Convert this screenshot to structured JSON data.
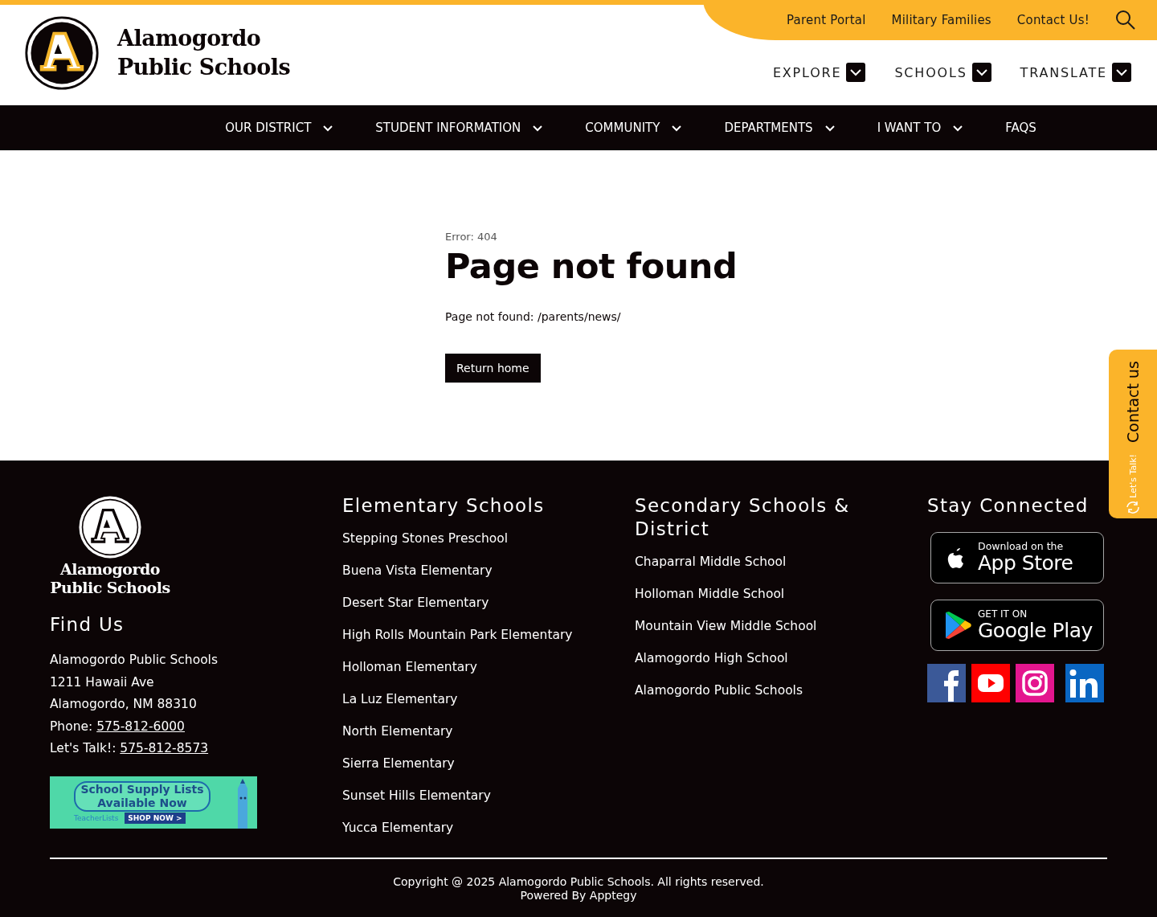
{
  "header": {
    "logo_text": [
      "Alamogordo",
      "Public Schools"
    ],
    "utility_links": [
      "Parent Portal",
      "Military Families",
      "Contact Us!"
    ],
    "dropdowns": [
      "EXPLORE",
      "SCHOOLS",
      "TRANSLATE"
    ]
  },
  "nav": [
    {
      "label": "OUR DISTRICT",
      "has_menu": true
    },
    {
      "label": "STUDENT INFORMATION",
      "has_menu": true
    },
    {
      "label": "COMMUNITY",
      "has_menu": true
    },
    {
      "label": "DEPARTMENTS",
      "has_menu": true
    },
    {
      "label": "I WANT TO",
      "has_menu": true
    },
    {
      "label": "FAQS",
      "has_menu": false
    }
  ],
  "error": {
    "code": "Error: 404",
    "title": "Page not found",
    "message": "Page not found: /parents/news/",
    "button": "Return home"
  },
  "contact_tab": {
    "label": "Contact us",
    "sub": "Let's Talk!"
  },
  "footer": {
    "logo_text": [
      "Alamogordo",
      "Public Schools"
    ],
    "find_us": {
      "heading": "Find Us",
      "lines": [
        "Alamogordo Public Schools",
        "1211 Hawaii Ave",
        "Alamogordo, NM 88310"
      ],
      "phones": [
        {
          "label": "Phone: ",
          "number": "575-812-6000"
        },
        {
          "label": "Let's Talk!: ",
          "number": "575-812-8573"
        }
      ]
    },
    "banner": {
      "title": "School Supply Lists Available Now",
      "brand": "TeacherLists",
      "cta": "SHOP NOW >"
    },
    "columns": [
      {
        "heading": "Elementary Schools",
        "links": [
          "Stepping Stones Preschool",
          "Buena Vista Elementary",
          "Desert Star Elementary",
          "High Rolls Mountain Park Elementary",
          "Holloman Elementary",
          "La Luz Elementary",
          "North Elementary",
          "Sierra Elementary",
          "Sunset Hills Elementary",
          "Yucca Elementary"
        ]
      },
      {
        "heading": "Secondary Schools & District",
        "links": [
          "Chaparral Middle School",
          "Holloman Middle School",
          "Mountain View Middle School",
          "Alamogordo High School",
          "Alamogordo Public Schools"
        ]
      }
    ],
    "connected": {
      "heading": "Stay Connected",
      "stores": [
        {
          "kind": "apple",
          "small": "Download on the",
          "big": "App Store"
        },
        {
          "kind": "google",
          "small": "GET IT ON",
          "big": "Google Play"
        }
      ],
      "social": [
        {
          "kind": "facebook",
          "color": "#3b5998"
        },
        {
          "kind": "youtube",
          "color": "#ff0000"
        },
        {
          "kind": "instagram",
          "color": "#e4168e"
        },
        {
          "kind": "linkedin",
          "color": "#0a66c2"
        }
      ]
    },
    "copyright": "Copyright @ 2025 Alamogordo Public Schools. All rights reserved.",
    "powered": "Powered By Apptegy"
  }
}
